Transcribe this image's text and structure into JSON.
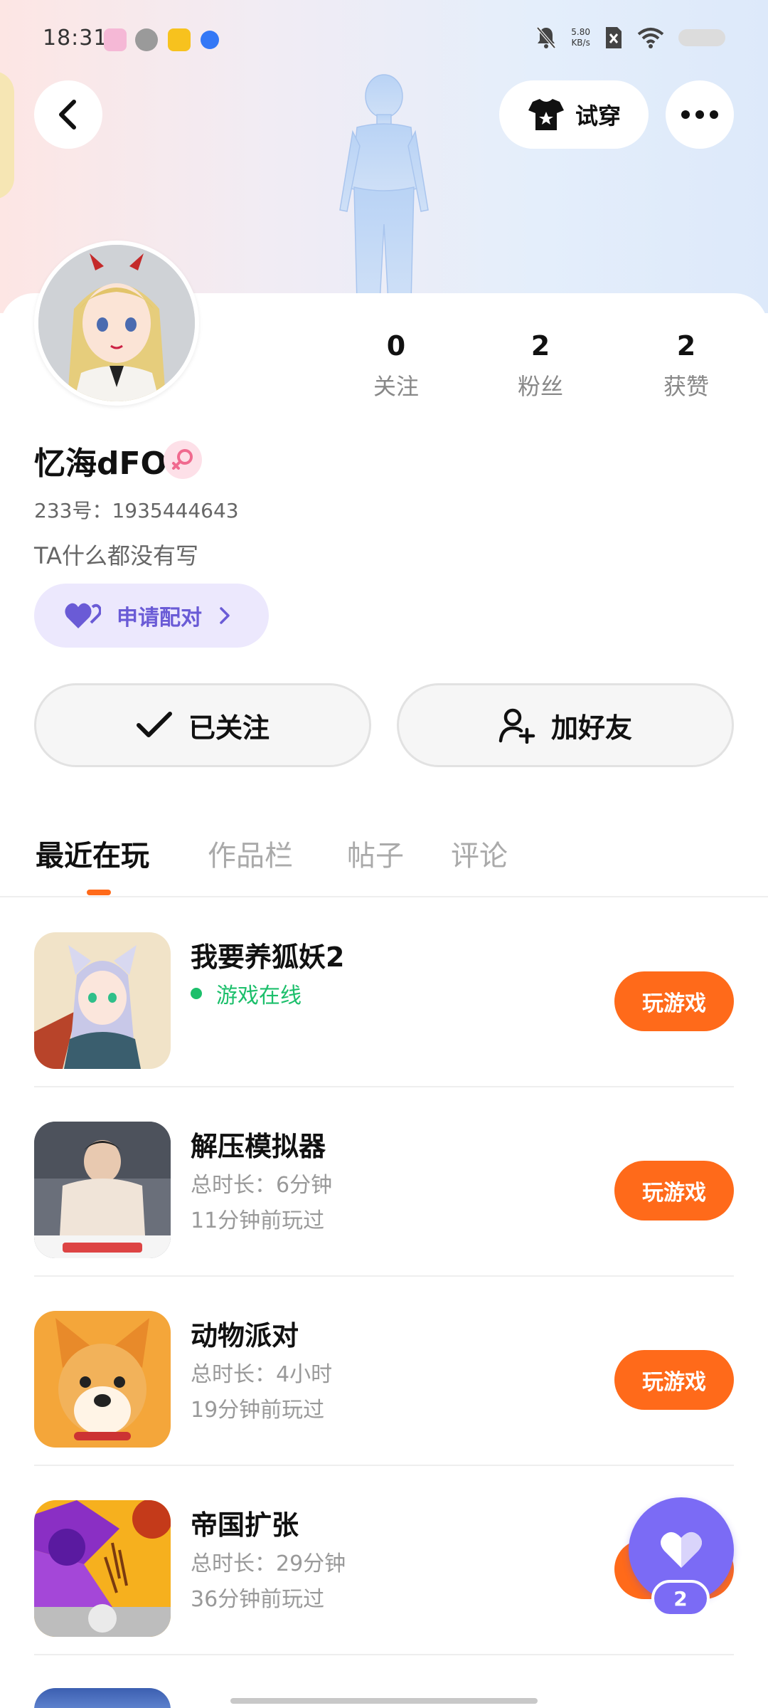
{
  "status_bar": {
    "time": "18:31",
    "net_speed_value": "5.80",
    "net_speed_unit": "KB/s"
  },
  "header": {
    "try_on_label": "试穿"
  },
  "profile": {
    "nickname": "忆海dFO",
    "uid_label": "233号：",
    "uid": "1935444643",
    "bio": "TA什么都没有写",
    "pair_label": "申请配对"
  },
  "stats": [
    {
      "value": "0",
      "label": "关注"
    },
    {
      "value": "2",
      "label": "粉丝"
    },
    {
      "value": "2",
      "label": "获赞"
    }
  ],
  "actions": {
    "followed_label": "已关注",
    "add_friend_label": "加好友"
  },
  "tabs": [
    {
      "label": "最近在玩"
    },
    {
      "label": "作品栏"
    },
    {
      "label": "帖子"
    },
    {
      "label": "评论"
    }
  ],
  "games": [
    {
      "title": "我要养狐妖2",
      "status": "游戏在线",
      "play_label": "玩游戏"
    },
    {
      "title": "解压模拟器",
      "duration": "总时长：6分钟",
      "last_played": "11分钟前玩过",
      "play_label": "玩游戏"
    },
    {
      "title": "动物派对",
      "duration": "总时长：4小时",
      "last_played": "19分钟前玩过",
      "play_label": "玩游戏"
    },
    {
      "title": "帝国扩张",
      "duration": "总时长：29分钟",
      "last_played": "36分钟前玩过",
      "play_label": "玩游戏"
    }
  ],
  "like_fab": {
    "count": "2"
  },
  "colors": {
    "accent_orange": "#ff6a1a",
    "accent_purple": "#7b6bf5",
    "online_green": "#1cbf6b",
    "pair_bg": "#ece8fd"
  }
}
